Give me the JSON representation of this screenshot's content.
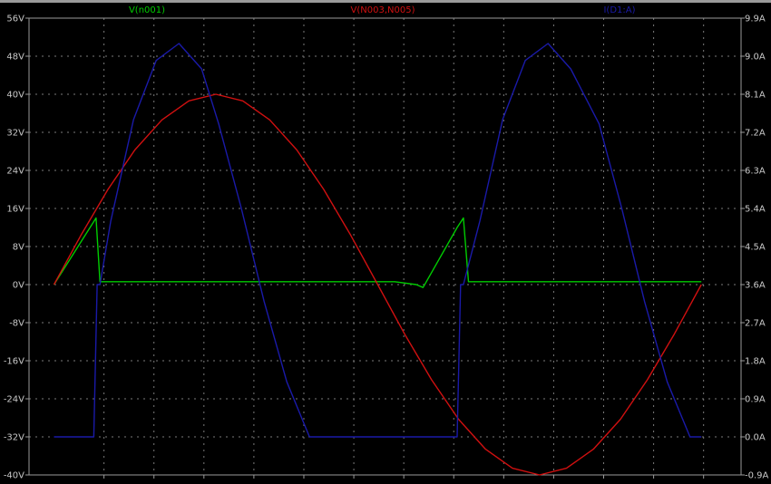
{
  "chart_data": {
    "type": "line",
    "series": [
      {
        "name": "V(n001)",
        "color": "#00cc00",
        "axis": "left",
        "x": [
          0.0,
          0.0074,
          0.0081,
          0.0088,
          0.03,
          0.06,
          0.0638,
          0.065,
          0.071,
          0.0721,
          0.073,
          0.09,
          0.1,
          0.114
        ],
        "values": [
          0.0,
          14.0,
          0.6,
          0.6,
          0.6,
          0.6,
          0.0,
          -0.6,
          12.0,
          14.0,
          0.6,
          0.6,
          0.6,
          0.6
        ]
      },
      {
        "name": "V(N003,N005)",
        "color": "#d01010",
        "axis": "left",
        "x": [
          0.0,
          0.00475,
          0.0095,
          0.01425,
          0.019,
          0.02375,
          0.0285,
          0.03325,
          0.038,
          0.04275,
          0.0475,
          0.05225,
          0.057,
          0.06175,
          0.0665,
          0.07125,
          0.076,
          0.08075,
          0.0855,
          0.09025,
          0.095,
          0.09975,
          0.1045,
          0.10925,
          0.114
        ],
        "values": [
          0.0,
          10.4,
          20.0,
          28.3,
          34.6,
          38.6,
          40.0,
          38.6,
          34.6,
          28.3,
          20.0,
          10.4,
          0.0,
          -10.4,
          -20.0,
          -28.3,
          -34.6,
          -38.6,
          -40.0,
          -38.6,
          -34.6,
          -28.3,
          -20.0,
          -10.4,
          0.0
        ]
      },
      {
        "name": "I(D1:A)",
        "color": "#1a1aa8",
        "axis": "right",
        "x": [
          0.0,
          0.007,
          0.0076,
          0.0081,
          0.01,
          0.014,
          0.018,
          0.022,
          0.026,
          0.029,
          0.033,
          0.037,
          0.041,
          0.045,
          0.049,
          0.053,
          0.056,
          0.057,
          0.06,
          0.064,
          0.068,
          0.071,
          0.0716,
          0.0721,
          0.075,
          0.079,
          0.083,
          0.087,
          0.091,
          0.096,
          0.1,
          0.104,
          0.108,
          0.112,
          0.114
        ],
        "values": [
          0.0,
          0.0,
          3.6,
          3.6,
          5.1,
          7.5,
          8.9,
          9.3,
          8.7,
          7.4,
          5.4,
          3.2,
          1.3,
          0.0,
          0.0,
          0.0,
          0.0,
          0.0,
          0.0,
          0.0,
          0.0,
          0.0,
          3.6,
          3.6,
          5.1,
          7.5,
          8.9,
          9.3,
          8.7,
          7.4,
          5.4,
          3.2,
          1.3,
          0.0,
          0.0
        ]
      }
    ],
    "xlim": [
      -0.0044,
      0.121
    ],
    "ylim_left": [
      -40,
      56
    ],
    "ylim_right": [
      -0.9,
      9.9
    ],
    "yticks_left": [
      "56V",
      "48V",
      "40V",
      "32V",
      "24V",
      "16V",
      "8V",
      "0V",
      "-8V",
      "-16V",
      "-24V",
      "-32V",
      "-40V"
    ],
    "yticks_right": [
      "9.9A",
      "9.0A",
      "8.1A",
      "7.2A",
      "6.3A",
      "5.4A",
      "4.5A",
      "3.6A",
      "2.7A",
      "1.8A",
      "0.9A",
      "0.0A",
      "-0.9A"
    ],
    "x_gridlines": [
      0.0088,
      0.0176,
      0.0264,
      0.0352,
      0.044,
      0.0528,
      0.0616,
      0.0704,
      0.0792,
      0.088,
      0.0968,
      0.1056,
      0.1144
    ],
    "grid": true,
    "background": "#000000"
  }
}
